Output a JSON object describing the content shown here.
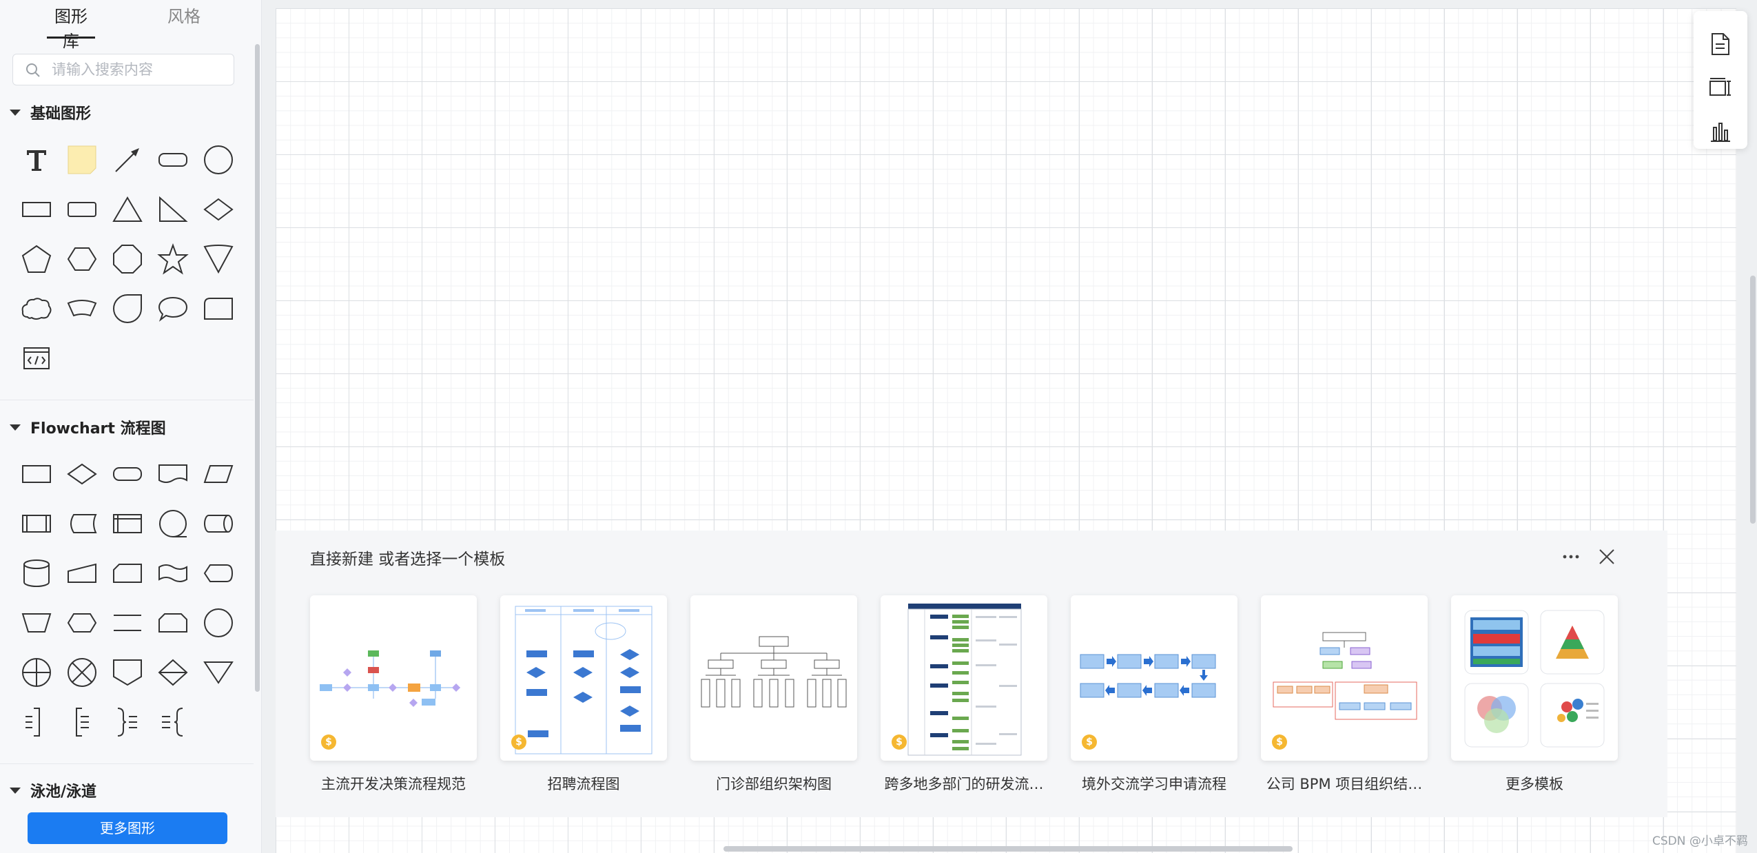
{
  "sidebar": {
    "tabs": [
      {
        "label": "图形库"
      },
      {
        "label": "风格"
      }
    ],
    "search_placeholder": "请输入搜索内容",
    "sections": [
      {
        "title": "基础图形"
      },
      {
        "title": "Flowchart 流程图"
      },
      {
        "title": "泳池/泳道"
      }
    ],
    "more_button": "更多图形"
  },
  "template_panel": {
    "title": "直接新建 或者选择一个模板",
    "templates": [
      {
        "label": "主流开发决策流程规范",
        "paid": true
      },
      {
        "label": "招聘流程图",
        "paid": true
      },
      {
        "label": "门诊部组织架构图",
        "paid": false
      },
      {
        "label": "跨多地多部门的研发流…",
        "paid": true
      },
      {
        "label": "境外交流学习申请流程",
        "paid": true
      },
      {
        "label": "公司 BPM 项目组织结…",
        "paid": true
      },
      {
        "label": "更多模板",
        "paid": false
      }
    ],
    "paid_badge": "$"
  },
  "watermark": "CSDN @小卓不羁",
  "colors": {
    "accent": "#1b7cf2",
    "badge": "#f5b731"
  }
}
